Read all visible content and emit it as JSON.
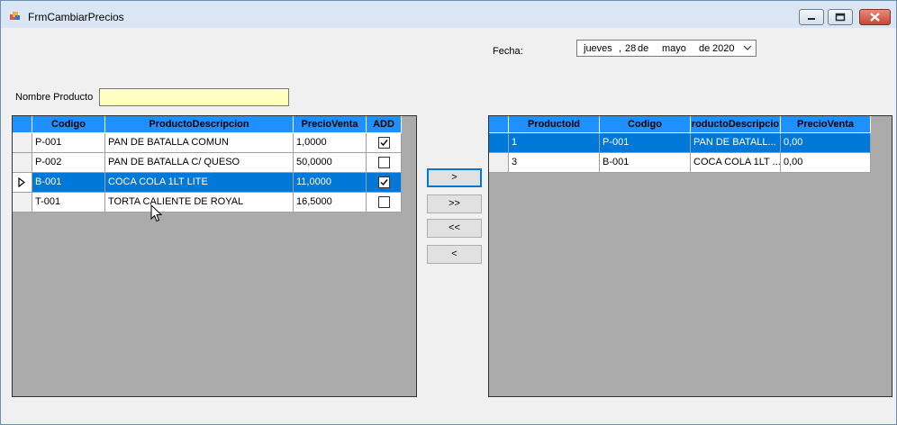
{
  "window": {
    "title": "FrmCambiarPrecios"
  },
  "fecha": {
    "label": "Fecha:",
    "day_name": "jueves",
    "day_sep": ",",
    "day": "28",
    "de1": "de",
    "month": "mayo",
    "de2": "de",
    "year": "2020"
  },
  "nombre_producto": {
    "label": "Nombre Producto",
    "value": ""
  },
  "left_grid": {
    "columns": [
      "Codigo",
      "ProductoDescripcion",
      "PrecioVenta",
      "ADD"
    ],
    "rows": [
      {
        "codigo": "P-001",
        "descripcion": "PAN DE BATALLA COMUN",
        "precio": "1,0000",
        "add": true
      },
      {
        "codigo": "P-002",
        "descripcion": "PAN DE BATALLA C/ QUESO",
        "precio": "50,0000",
        "add": false
      },
      {
        "codigo": "B-001",
        "descripcion": "COCA COLA 1LT LITE",
        "precio": "11,0000",
        "add": true
      },
      {
        "codigo": "T-001",
        "descripcion": "TORTA CALIENTE DE ROYAL",
        "precio": "16,5000",
        "add": false
      }
    ]
  },
  "buttons": {
    "move_right": ">",
    "move_all_right": ">>",
    "move_all_left": "<<",
    "move_left": "<"
  },
  "right_grid": {
    "columns": [
      "ProductoId",
      "Codigo",
      "roductoDescripcio",
      "PrecioVenta"
    ],
    "rows": [
      {
        "id": "1",
        "codigo": "P-001",
        "descripcion": "PAN DE BATALL...",
        "precio": "0,00"
      },
      {
        "id": "3",
        "codigo": "B-001",
        "descripcion": "COCA COLA 1LT ...",
        "precio": "0,00"
      }
    ]
  },
  "colors": {
    "header": "#1e90ff",
    "selection": "#0078d7",
    "grid_bg": "#ababab",
    "input_bg": "#ffffc0"
  }
}
